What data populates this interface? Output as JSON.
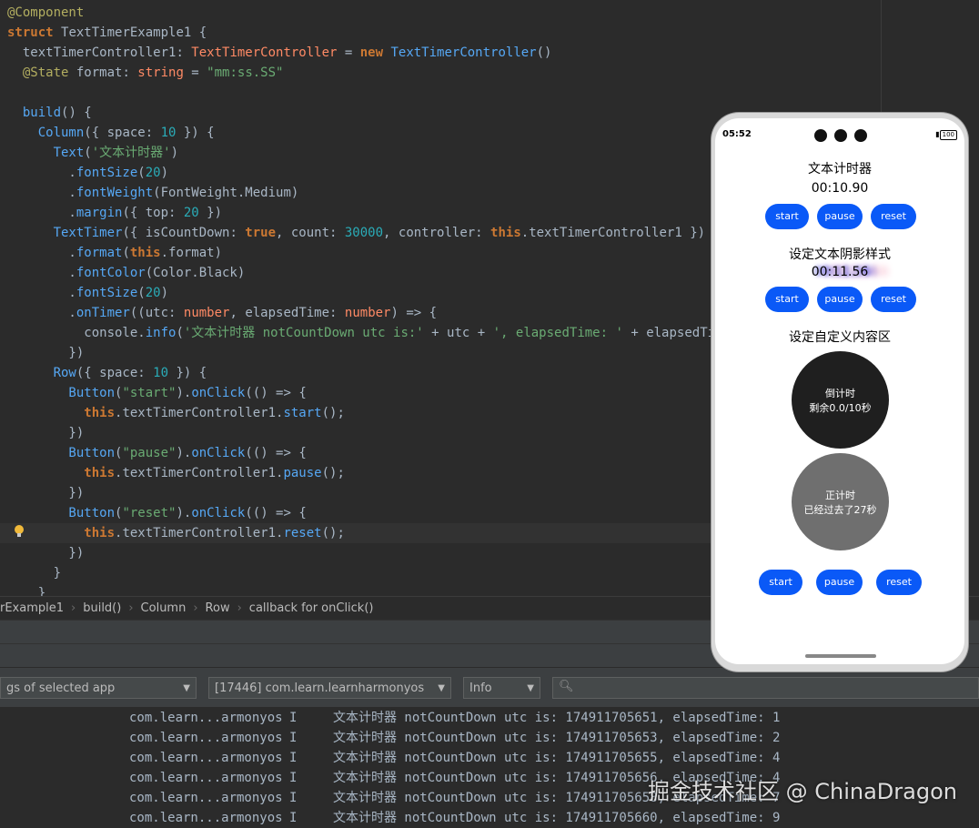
{
  "code": [
    [
      [
        "ann",
        "@Component"
      ]
    ],
    [
      [
        "kw",
        "struct "
      ],
      [
        "cls",
        "TextTimerExample1 "
      ],
      [
        "cls",
        "{"
      ]
    ],
    [
      [
        "cls",
        "  textTimerController1"
      ],
      [
        "cls",
        ": "
      ],
      [
        "typeref",
        "TextTimerController"
      ],
      [
        "cls",
        " = "
      ],
      [
        "kw",
        "new "
      ],
      [
        "fn",
        "TextTimerController"
      ],
      [
        "cls",
        "()"
      ]
    ],
    [
      [
        "ann",
        "  @State "
      ],
      [
        "cls",
        "format"
      ],
      [
        "cls",
        ": "
      ],
      [
        "typeref",
        "string"
      ],
      [
        "cls",
        " = "
      ],
      [
        "str",
        "\"mm:ss.SS\""
      ]
    ],
    [
      [
        "cls",
        ""
      ]
    ],
    [
      [
        "fn",
        "  build"
      ],
      [
        "cls",
        "() {"
      ]
    ],
    [
      [
        "fn",
        "    Column"
      ],
      [
        "cls",
        "({ space: "
      ],
      [
        "num",
        "10"
      ],
      [
        "cls",
        " }) {"
      ]
    ],
    [
      [
        "fn",
        "      Text"
      ],
      [
        "cls",
        "("
      ],
      [
        "str",
        "'文本计时器'"
      ],
      [
        "cls",
        ")"
      ]
    ],
    [
      [
        "cls",
        "        ."
      ],
      [
        "method",
        "fontSize"
      ],
      [
        "cls",
        "("
      ],
      [
        "num",
        "20"
      ],
      [
        "cls",
        ")"
      ]
    ],
    [
      [
        "cls",
        "        ."
      ],
      [
        "method",
        "fontWeight"
      ],
      [
        "cls",
        "(FontWeight.Medium)"
      ]
    ],
    [
      [
        "cls",
        "        ."
      ],
      [
        "method",
        "margin"
      ],
      [
        "cls",
        "({ top: "
      ],
      [
        "num",
        "20"
      ],
      [
        "cls",
        " })"
      ]
    ],
    [
      [
        "fn",
        "      TextTimer"
      ],
      [
        "cls",
        "({ isCountDown: "
      ],
      [
        "kw",
        "true"
      ],
      [
        "cls",
        ", count: "
      ],
      [
        "num",
        "30000"
      ],
      [
        "cls",
        ", controller: "
      ],
      [
        "kw",
        "this"
      ],
      [
        "cls",
        ".textTimerController1 })"
      ]
    ],
    [
      [
        "cls",
        "        ."
      ],
      [
        "method",
        "format"
      ],
      [
        "cls",
        "("
      ],
      [
        "kw",
        "this"
      ],
      [
        "cls",
        ".format)"
      ]
    ],
    [
      [
        "cls",
        "        ."
      ],
      [
        "method",
        "fontColor"
      ],
      [
        "cls",
        "(Color.Black)"
      ]
    ],
    [
      [
        "cls",
        "        ."
      ],
      [
        "method",
        "fontSize"
      ],
      [
        "cls",
        "("
      ],
      [
        "num",
        "20"
      ],
      [
        "cls",
        ")"
      ]
    ],
    [
      [
        "cls",
        "        ."
      ],
      [
        "method",
        "onTimer"
      ],
      [
        "cls",
        "((utc: "
      ],
      [
        "typeref",
        "number"
      ],
      [
        "cls",
        ", elapsedTime: "
      ],
      [
        "typeref",
        "number"
      ],
      [
        "cls",
        ") => {"
      ]
    ],
    [
      [
        "cls",
        "          console."
      ],
      [
        "method",
        "info"
      ],
      [
        "cls",
        "("
      ],
      [
        "str",
        "'文本计时器 notCountDown utc is:'"
      ],
      [
        "cls",
        " + utc + "
      ],
      [
        "str",
        "', elapsedTime: '"
      ],
      [
        "cls",
        " + elapsedTime);"
      ]
    ],
    [
      [
        "cls",
        "        })"
      ]
    ],
    [
      [
        "fn",
        "      Row"
      ],
      [
        "cls",
        "({ space: "
      ],
      [
        "num",
        "10"
      ],
      [
        "cls",
        " }) {"
      ]
    ],
    [
      [
        "fn",
        "        Button"
      ],
      [
        "cls",
        "("
      ],
      [
        "str",
        "\"start\""
      ],
      [
        "cls",
        ")."
      ],
      [
        "method",
        "onClick"
      ],
      [
        "cls",
        "(() => {"
      ]
    ],
    [
      [
        "kw",
        "          this"
      ],
      [
        "cls",
        ".textTimerController1."
      ],
      [
        "method",
        "start"
      ],
      [
        "cls",
        "();"
      ]
    ],
    [
      [
        "cls",
        "        })"
      ]
    ],
    [
      [
        "fn",
        "        Button"
      ],
      [
        "cls",
        "("
      ],
      [
        "str",
        "\"pause\""
      ],
      [
        "cls",
        ")."
      ],
      [
        "method",
        "onClick"
      ],
      [
        "cls",
        "(() => {"
      ]
    ],
    [
      [
        "kw",
        "          this"
      ],
      [
        "cls",
        ".textTimerController1."
      ],
      [
        "method",
        "pause"
      ],
      [
        "cls",
        "();"
      ]
    ],
    [
      [
        "cls",
        "        })"
      ]
    ],
    [
      [
        "fn",
        "        Button"
      ],
      [
        "cls",
        "("
      ],
      [
        "str",
        "\"reset\""
      ],
      [
        "cls",
        ")."
      ],
      [
        "method",
        "onClick"
      ],
      [
        "cls",
        "(() => {"
      ]
    ],
    [
      [
        "kw",
        "          this"
      ],
      [
        "cls",
        ".textTimerController1."
      ],
      [
        "method",
        "reset"
      ],
      [
        "cls",
        "();"
      ]
    ],
    [
      [
        "cls",
        "        })"
      ]
    ],
    [
      [
        "cls",
        "      }"
      ]
    ],
    [
      [
        "cls",
        "    }"
      ]
    ]
  ],
  "colors": {
    "ann": "#b3ae60",
    "kw": "#cc7832",
    "fn": "#56a8f5",
    "str": "#6aab73",
    "num": "#2aacb8",
    "typeref": "#ff8a65",
    "cls": "#a9b7c6",
    "method": "#56a8f5",
    "accent": "#0a59f7"
  },
  "breadcrumb": [
    "rExample1",
    "build()",
    "Column",
    "Row",
    "callback for onClick()"
  ],
  "logcat": {
    "filter": "gs of selected app",
    "process": "[17446] com.learn.learnharmonyos",
    "level": "Info",
    "rows": [
      {
        "pkg": "com.learn...armonyos",
        "lvl": "I",
        "msg": "文本计时器 notCountDown utc is: 174911705651, elapsedTime: 1"
      },
      {
        "pkg": "com.learn...armonyos",
        "lvl": "I",
        "msg": "文本计时器 notCountDown utc is: 174911705653, elapsedTime: 2"
      },
      {
        "pkg": "com.learn...armonyos",
        "lvl": "I",
        "msg": "文本计时器 notCountDown utc is: 174911705655, elapsedTime: 4"
      },
      {
        "pkg": "com.learn...armonyos",
        "lvl": "I",
        "msg": "文本计时器 notCountDown utc is: 174911705656, elapsedTime: 4"
      },
      {
        "pkg": "com.learn...armonyos",
        "lvl": "I",
        "msg": "文本计时器 notCountDown utc is: 174911705658, elapsedTime: 7"
      },
      {
        "pkg": "com.learn...armonyos",
        "lvl": "I",
        "msg": "文本计时器 notCountDown utc is: 174911705660, elapsedTime: 9"
      }
    ]
  },
  "watermark": "掘金技术社区 @ ChinaDragon",
  "phone": {
    "time": "05:52",
    "battery": "100",
    "title1": "文本计时器",
    "timer1": "00:10.90",
    "title2": "设定文本阴影样式",
    "timer2": "00:11.56",
    "title3": "设定自定义内容区",
    "circle1_line1": "倒计时",
    "circle1_line2": "剩余0.0/10秒",
    "circle2_line1": "正计时",
    "circle2_line2": "已经过去了27秒",
    "btn_start": "start",
    "btn_pause": "pause",
    "btn_reset": "reset"
  }
}
